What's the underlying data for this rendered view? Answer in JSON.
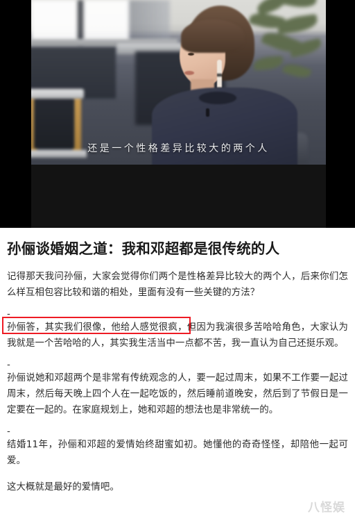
{
  "media": {
    "subtitle": "还是一个性格差异比较大的两个人",
    "scene_description": "短发女士侧脸坐在室内，身穿深蓝上衣，佩戴长耳坠，背景有绿植",
    "letterbox_color": "#000000",
    "player_background": "#131313"
  },
  "article": {
    "title": "孙俪谈婚姻之道：我和邓超都是很传统的人",
    "separator": "-",
    "paragraphs": [
      "记得那天我问孙俪，大家会觉得你们两个是性格差异比较大的两个人，后来你们怎么样互相包容比较和谐的相处，里面有没有一些关键的方法？",
      "孙俪答，其实我们很像，他给人感觉很疯，但因为我演很多苦哈哈角色，大家认为我就是一个苦哈哈的人，其实我生活当中一点都不苦，我一直认为自己还挺乐观。",
      "孙俪说她和邓超两个是非常有传统观念的人，要一起过周末，如果不工作要一起过周末，然后每天晚上四个人在一起吃饭的，然后睡前道晚安，然后到了节假日是一定要在一起的。在家庭规划上，她和邓超的想法也是非常统一的。",
      "结婚11年，孙俪和邓超的爱情始终甜蜜如初。她懂他的奇奇怪怪，却陪他一起可爱。",
      "这大概就是最好的爱情吧。"
    ],
    "highlight": {
      "text": "孙俪答，其实我们很像，他给人感觉很疯，",
      "border_color": "#ee1b24"
    }
  },
  "watermark": {
    "text": "八怪娱",
    "color": "#d9d9d9"
  }
}
